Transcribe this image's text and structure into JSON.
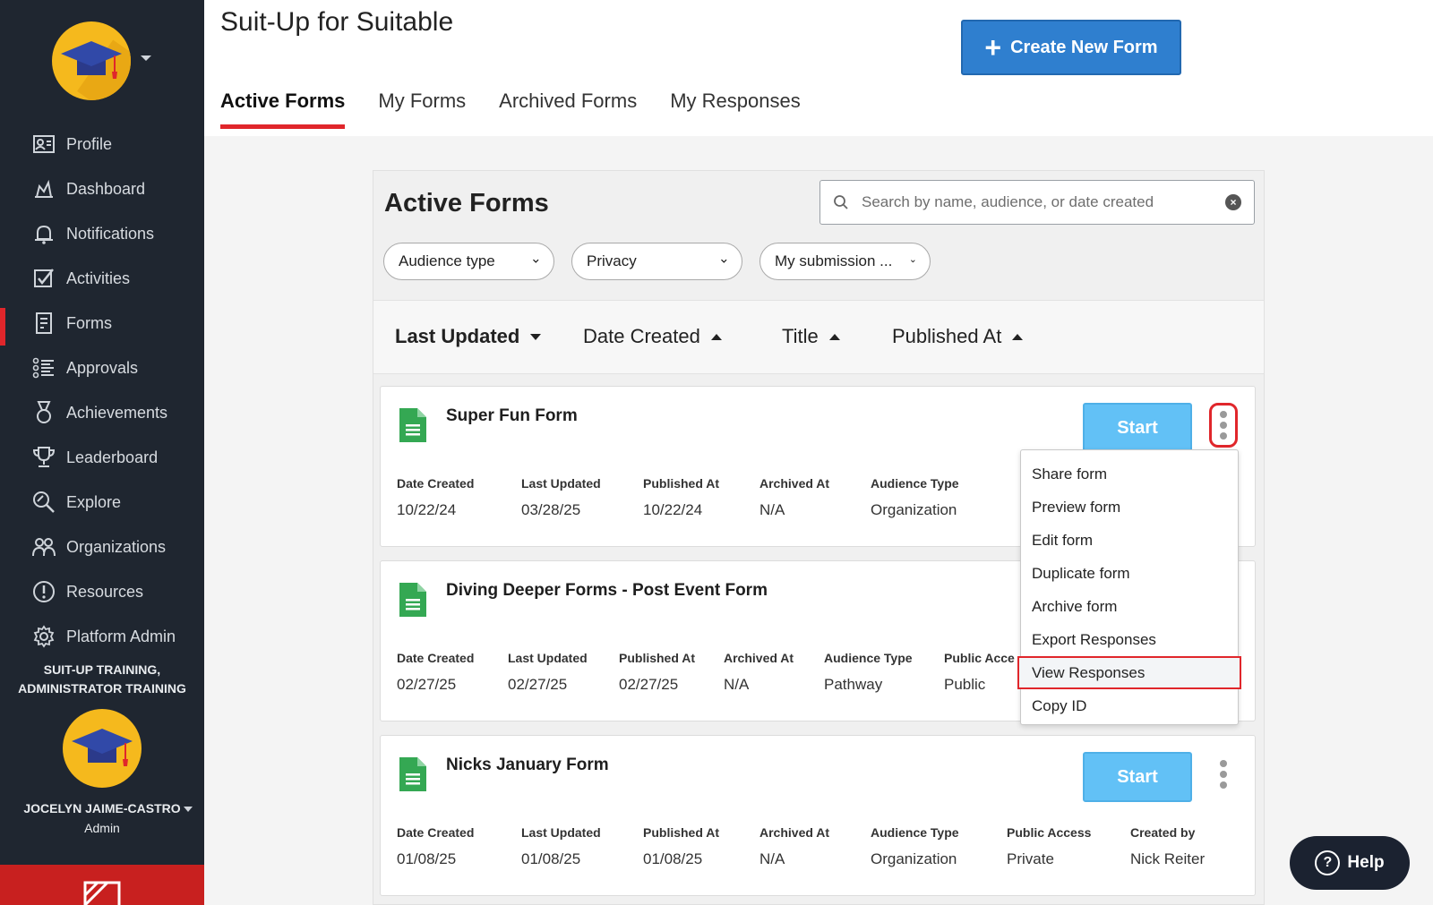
{
  "app": {
    "title": "Suit-Up for Suitable"
  },
  "header": {
    "create_button": "Create New Form",
    "tabs": [
      "Active Forms",
      "My Forms",
      "Archived Forms",
      "My Responses"
    ]
  },
  "sidebar": {
    "items": [
      {
        "label": "Profile",
        "icon": "profile-card-icon"
      },
      {
        "label": "Dashboard",
        "icon": "dashboard-icon"
      },
      {
        "label": "Notifications",
        "icon": "bell-icon"
      },
      {
        "label": "Activities",
        "icon": "checkbox-icon"
      },
      {
        "label": "Forms",
        "icon": "form-document-icon"
      },
      {
        "label": "Approvals",
        "icon": "list-icon"
      },
      {
        "label": "Achievements",
        "icon": "medal-icon"
      },
      {
        "label": "Leaderboard",
        "icon": "trophy-icon"
      },
      {
        "label": "Explore",
        "icon": "explore-icon"
      },
      {
        "label": "Organizations",
        "icon": "people-icon"
      },
      {
        "label": "Resources",
        "icon": "info-circle-icon"
      },
      {
        "label": "Platform Admin",
        "icon": "gear-icon"
      }
    ],
    "org_line1": "SUIT-UP TRAINING,",
    "org_line2": "ADMINISTRATOR TRAINING",
    "user_name": "JOCELYN JAIME-CASTRO",
    "user_role": "Admin"
  },
  "panel": {
    "title": "Active Forms",
    "search_placeholder": "Search by name, audience, or date created",
    "filters": [
      "Audience type",
      "Privacy",
      "My submission ..."
    ],
    "sort": [
      "Last Updated",
      "Date Created",
      "Title",
      "Published At"
    ]
  },
  "forms": [
    {
      "title": "Super Fun Form",
      "start_label": "Start",
      "fields": [
        {
          "label": "Date Created",
          "value": "10/22/24"
        },
        {
          "label": "Last Updated",
          "value": "03/28/25"
        },
        {
          "label": "Published At",
          "value": "10/22/24"
        },
        {
          "label": "Archived At",
          "value": "N/A"
        },
        {
          "label": "Audience Type",
          "value": "Organization"
        }
      ]
    },
    {
      "title": "Diving Deeper Forms - Post Event Form",
      "fields": [
        {
          "label": "Date Created",
          "value": "02/27/25"
        },
        {
          "label": "Last Updated",
          "value": "02/27/25"
        },
        {
          "label": "Published At",
          "value": "02/27/25"
        },
        {
          "label": "Archived At",
          "value": "N/A"
        },
        {
          "label": "Audience Type",
          "value": "Pathway"
        },
        {
          "label": "Public Acce",
          "value": "Public"
        }
      ]
    },
    {
      "title": "Nicks January Form",
      "start_label": "Start",
      "fields": [
        {
          "label": "Date Created",
          "value": "01/08/25"
        },
        {
          "label": "Last Updated",
          "value": "01/08/25"
        },
        {
          "label": "Published At",
          "value": "01/08/25"
        },
        {
          "label": "Archived At",
          "value": "N/A"
        },
        {
          "label": "Audience Type",
          "value": "Organization"
        },
        {
          "label": "Public Access",
          "value": "Private"
        },
        {
          "label": "Created by",
          "value": "Nick Reiter"
        }
      ]
    }
  ],
  "menu": {
    "items": [
      "Share form",
      "Preview form",
      "Edit form",
      "Duplicate form",
      "Archive form",
      "Export Responses",
      "View Responses",
      "Copy ID"
    ],
    "selected": "View Responses"
  },
  "help": {
    "label": "Help"
  },
  "colors": {
    "sidebar_bg": "#1f2630",
    "accent_red": "#e0262b",
    "primary_blue": "#2f7fcf",
    "start_blue": "#62c1f6",
    "logo_yellow": "#f5b91d"
  }
}
